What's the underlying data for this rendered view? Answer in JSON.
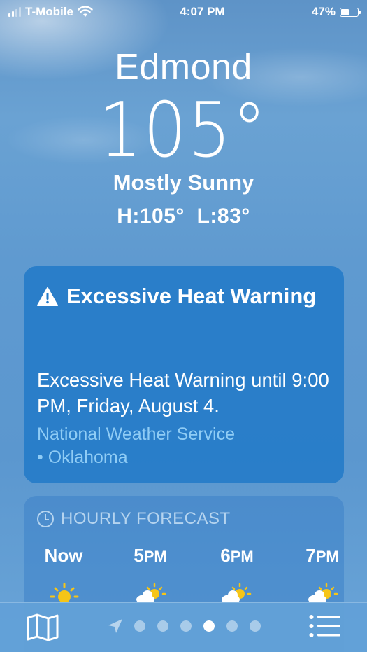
{
  "status_bar": {
    "carrier": "T-Mobile",
    "time": "4:07 PM",
    "battery": "47%",
    "battery_level": 0.47,
    "icons": [
      "signal-icon",
      "wifi-icon",
      "battery-icon"
    ]
  },
  "weather": {
    "city": "Edmond",
    "temperature": "105°",
    "condition": "Mostly Sunny",
    "high_low": "H:105°  L:83°"
  },
  "alert": {
    "title": "Excessive Heat Warning",
    "icon": "warning-icon",
    "body": "Excessive Heat Warning until 9:00 PM, Friday, August 4.",
    "source_line1": "National Weather Service",
    "source_line2": "• Oklahoma"
  },
  "hourly": {
    "header": "HOURLY FORECAST",
    "icon": "clock-icon",
    "hours": [
      {
        "label": "Now",
        "suffix": "",
        "icon": "sun-icon"
      },
      {
        "label": "5",
        "suffix": "PM",
        "icon": "partly-cloudy-icon"
      },
      {
        "label": "6",
        "suffix": "PM",
        "icon": "partly-cloudy-icon"
      },
      {
        "label": "7",
        "suffix": "PM",
        "icon": "partly-cloudy-icon"
      }
    ]
  },
  "bottom_bar": {
    "page_count": 6,
    "active_page": 4,
    "icons": [
      "map-icon",
      "location-arrow-icon",
      "list-icon"
    ]
  },
  "colors": {
    "alert_card": "#2179c8",
    "source_link": "#8fccf5",
    "sun": "#f5c518"
  }
}
